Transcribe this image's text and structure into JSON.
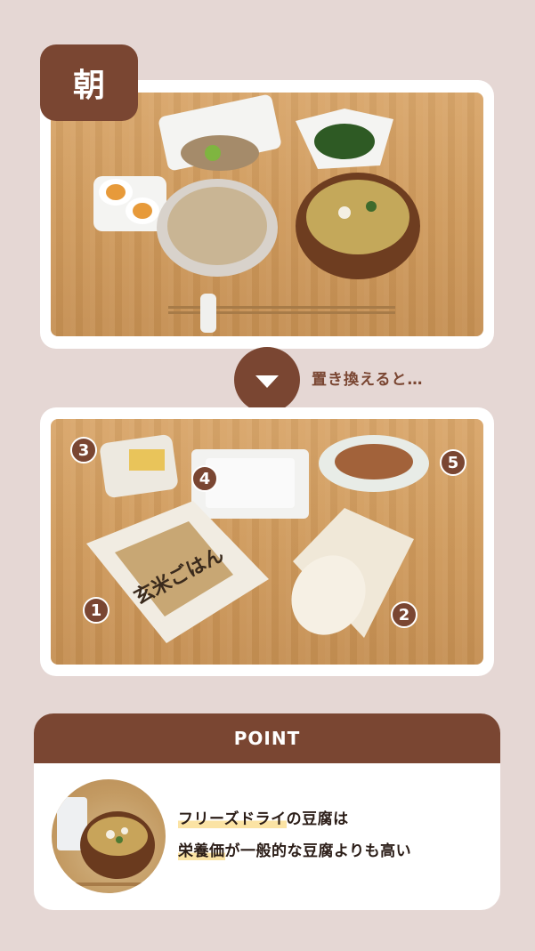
{
  "top_section": {
    "badge_label": "朝",
    "photo_description_items": [
      "natto",
      "boiled egg",
      "brown rice",
      "miso soup",
      "spinach"
    ]
  },
  "transition": {
    "label": "置き換えると…"
  },
  "bottom_section": {
    "markers": [
      "1",
      "2",
      "3",
      "4",
      "5"
    ]
  },
  "point": {
    "header": "POINT",
    "line1_highlight": "フリーズドライ",
    "line1_rest": "の豆腐は",
    "line2_highlight": "栄養価",
    "line2_rest": "が一般的な豆腐よりも高い"
  },
  "colors": {
    "background": "#e5d7d4",
    "accent_brown": "#7a4632",
    "highlight": "#fbe3a4"
  }
}
